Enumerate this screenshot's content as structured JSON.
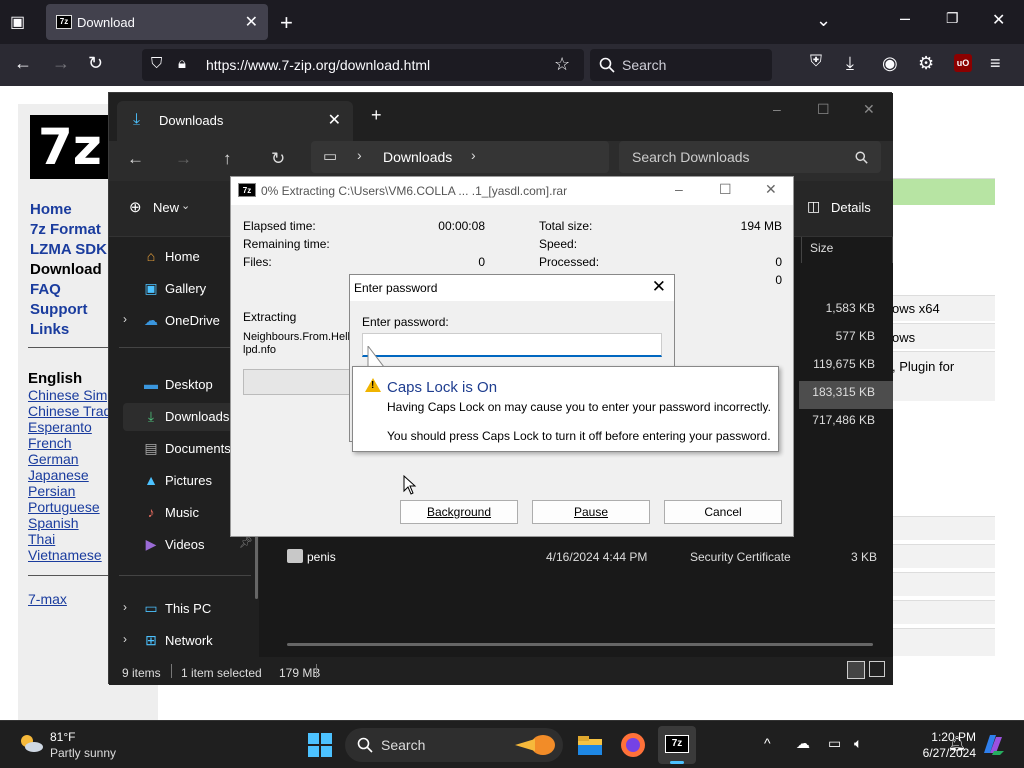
{
  "browser": {
    "tab_title": "Download",
    "url": "https://www.7-zip.org/download.html",
    "search_placeholder": "Search"
  },
  "site": {
    "logo_text": "7z",
    "nav": [
      "Home",
      "7z Format",
      "LZMA SDK",
      "Download",
      "FAQ",
      "Support",
      "Links"
    ],
    "current_nav": "Download",
    "languages_header": "English",
    "languages": [
      "Chinese Simp",
      "Chinese Trad",
      "Esperanto",
      "French",
      "German",
      "Japanese",
      "Persian",
      "Portuguese",
      "Spanish",
      "Thai",
      "Vietnamese"
    ],
    "extra_link": "7-max",
    "right_snippets": [
      "ows x64",
      "ows",
      ", Plugin for"
    ]
  },
  "explorer": {
    "tab_title": "Downloads",
    "address": "Downloads",
    "search_placeholder": "Search Downloads",
    "new_label": "New",
    "details_label": "Details",
    "size_header": "Size",
    "sidebar": [
      {
        "label": "Home",
        "icon": "home-icon"
      },
      {
        "label": "Gallery",
        "icon": "gallery-icon"
      },
      {
        "label": "OneDrive",
        "icon": "cloud-icon"
      },
      {
        "label": "Desktop",
        "icon": "desktop-icon"
      },
      {
        "label": "Downloads",
        "icon": "download-icon"
      },
      {
        "label": "Documents",
        "icon": "documents-icon"
      },
      {
        "label": "Pictures",
        "icon": "pictures-icon"
      },
      {
        "label": "Music",
        "icon": "music-icon"
      },
      {
        "label": "Videos",
        "icon": "videos-icon"
      },
      {
        "label": "This PC",
        "icon": "pc-icon"
      },
      {
        "label": "Network",
        "icon": "network-icon"
      }
    ],
    "sizes": [
      "1,583 KB",
      "577 KB",
      "119,675 KB",
      "183,315 KB",
      "717,486 KB"
    ],
    "file_row": {
      "name": "penis",
      "date": "4/16/2024 4:44 PM",
      "type": "Security Certificate",
      "size": "3 KB"
    },
    "status": {
      "items": "9 items",
      "selected": "1 item selected",
      "selected_size": "179 MB"
    }
  },
  "zip_dialog": {
    "title": "0% Extracting C:\\Users\\VM6.COLLA ... .1_[yasdl.com].rar",
    "elapsed_label": "Elapsed time:",
    "elapsed_value": "00:00:08",
    "remaining_label": "Remaining time:",
    "files_label": "Files:",
    "files_value": "0",
    "total_size_label": "Total size:",
    "total_size_value": "194 MB",
    "speed_label": "Speed:",
    "processed_label": "Processed:",
    "processed_value": "0",
    "extra_value": "0",
    "extracting_label": "Extracting",
    "extracting_file_1": "Neighbours.From.Hell.1",
    "extracting_file_2": "lpd.nfo",
    "buttons": {
      "background": "Background",
      "pause": "Pause",
      "cancel": "Cancel"
    }
  },
  "password_dialog": {
    "title": "Enter password",
    "label": "Enter password:",
    "value": ""
  },
  "caps_tooltip": {
    "heading": "Caps Lock is On",
    "line1": "Having Caps Lock on may cause you to enter your password incorrectly.",
    "line2": "You should press Caps Lock to turn it off before entering your password."
  },
  "taskbar": {
    "temperature": "81°F",
    "condition": "Partly sunny",
    "search_label": "Search",
    "time": "1:20 PM",
    "date": "6/27/2024"
  }
}
